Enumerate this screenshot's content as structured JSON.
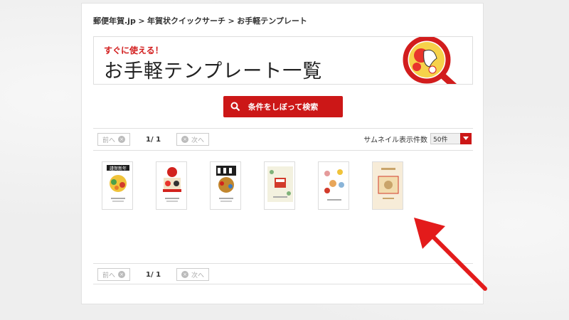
{
  "breadcrumb": {
    "home": "郵便年賀.jp",
    "sep": ">",
    "section": "年賀状クイックサーチ",
    "current": "お手軽テンプレート"
  },
  "banner": {
    "subtitle": "すぐに使える！",
    "title": "お手軽テンプレート一覧"
  },
  "search_button": {
    "label": "条件をしぼって検索",
    "icon": "search-icon"
  },
  "pager": {
    "prev": "前へ",
    "next": "次へ",
    "page": "1/ 1"
  },
  "thumbnail_count": {
    "label": "サムネイル表示件数",
    "selected": "50件"
  },
  "templates": [
    {
      "name": "template-1",
      "headline": "謹賀新年"
    },
    {
      "name": "template-2",
      "headline": ""
    },
    {
      "name": "template-3",
      "headline": ""
    },
    {
      "name": "template-4",
      "headline": ""
    },
    {
      "name": "template-5",
      "headline": ""
    },
    {
      "name": "template-6",
      "headline": ""
    }
  ],
  "colors": {
    "accent": "#cc1717",
    "banner_red": "#d21d1d"
  }
}
